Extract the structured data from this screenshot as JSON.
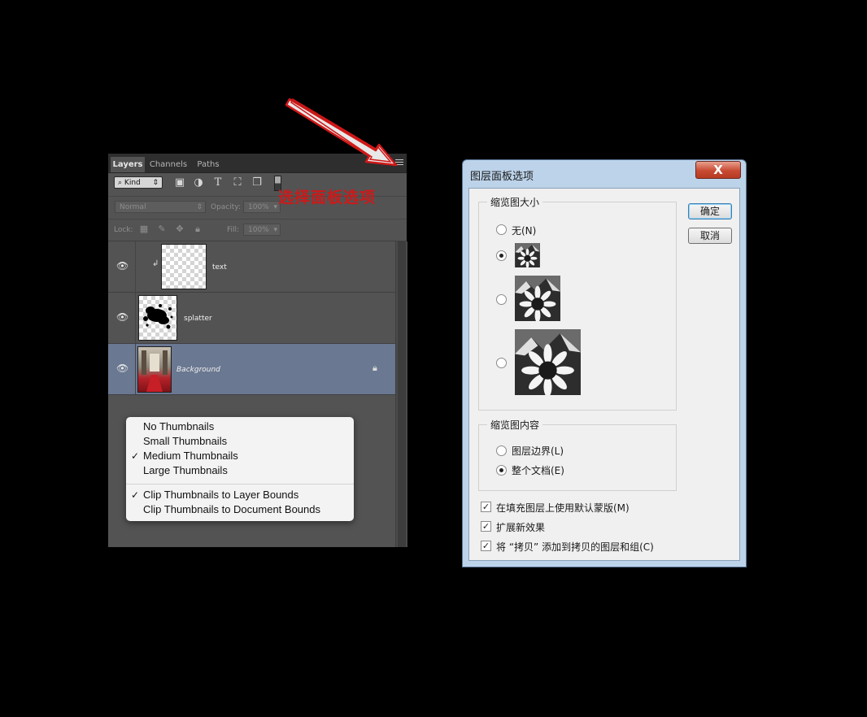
{
  "ps_panel": {
    "tabs": [
      "Layers",
      "Channels",
      "Paths"
    ],
    "kind_label": "Kind",
    "filter_icons": [
      "image-filter-icon",
      "adjustment-filter-icon",
      "type-filter-icon",
      "shape-filter-icon",
      "smart-object-filter-icon"
    ],
    "blend_mode": "Normal",
    "opacity_label": "Opacity:",
    "opacity_value": "100%",
    "lock_label": "Lock:",
    "fill_label": "Fill:",
    "fill_value": "100%",
    "layers": [
      {
        "name": "text",
        "visible": true,
        "selected": false
      },
      {
        "name": "splatter",
        "visible": true,
        "selected": false
      },
      {
        "name": "Background",
        "visible": true,
        "selected": true,
        "locked": true
      }
    ]
  },
  "context_menu": {
    "items": [
      {
        "label": "No Thumbnails",
        "checked": false
      },
      {
        "label": "Small Thumbnails",
        "checked": false
      },
      {
        "label": "Medium Thumbnails",
        "checked": true
      },
      {
        "label": "Large Thumbnails",
        "checked": false
      }
    ],
    "items2": [
      {
        "label": "Clip Thumbnails to Layer Bounds",
        "checked": true
      },
      {
        "label": "Clip Thumbnails to Document Bounds",
        "checked": false
      }
    ]
  },
  "annotation": {
    "text": "选择面板选项",
    "color": "#cc1a1a"
  },
  "dialog": {
    "title": "图层面板选项",
    "close_label": "X",
    "ok_label": "确定",
    "cancel_label": "取消",
    "thumb_size_group": "缩览图大小",
    "thumb_none_label": "无(N)",
    "thumb_size_selected": "small",
    "thumb_content_group": "缩览图内容",
    "layer_bounds_label": "图层边界(L)",
    "entire_doc_label": "整个文档(E)",
    "content_selected": "entire_document",
    "checkboxes": [
      {
        "label": "在填充图层上使用默认蒙版(M)",
        "checked": true
      },
      {
        "label": "扩展新效果",
        "checked": true
      },
      {
        "label": "将 “拷贝” 添加到拷贝的图层和组(C)",
        "checked": true
      }
    ]
  }
}
